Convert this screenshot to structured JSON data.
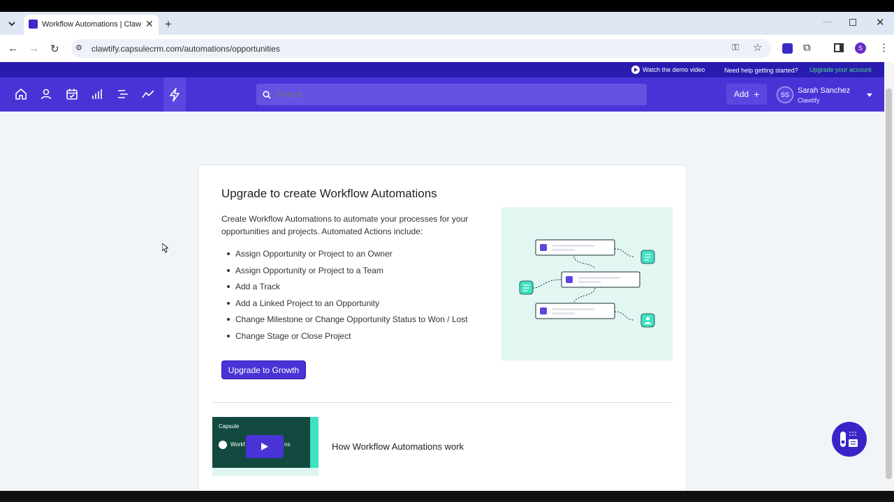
{
  "browser": {
    "tab_title": "Workflow Automations | Clawtif",
    "url": "clawtify.capsulecrm.com/automations/opportunities",
    "profile_initial": "S"
  },
  "topstrip": {
    "demo_video": "Watch the demo video",
    "help": "Need help getting started?",
    "upgrade_account": "Upgrade your account"
  },
  "nav": {
    "search_placeholder": "Search...",
    "add_label": "Add",
    "user": {
      "initials": "SS",
      "name": "Sarah Sanchez",
      "company": "Clawtify"
    },
    "icons": [
      "home-icon",
      "person-icon",
      "calendar-icon",
      "bar-chart-icon",
      "list-icon",
      "trend-icon",
      "lightning-icon"
    ]
  },
  "main": {
    "title": "Upgrade to create Workflow Automations",
    "description": "Create Workflow Automations to automate your processes for your opportunities and projects. Automated Actions include:",
    "bullets": [
      "Assign Opportunity or Project to an Owner",
      "Assign Opportunity or Project to a Team",
      "Add a Track",
      "Add a Linked Project to an Opportunity",
      "Change Milestone or Change Opportunity Status to Won / Lost",
      "Change Stage or Close Project"
    ],
    "upgrade_button": "Upgrade to Growth",
    "video": {
      "brand": "Capsule",
      "caption_left": "Workf",
      "caption_right": "ns",
      "title": "How Workflow Automations work"
    }
  },
  "colors": {
    "brand": "#4a33d6",
    "brand_dark": "#2a1bb0",
    "accent_green": "#3fe2c3",
    "upgrade_link": "#4ade80"
  }
}
